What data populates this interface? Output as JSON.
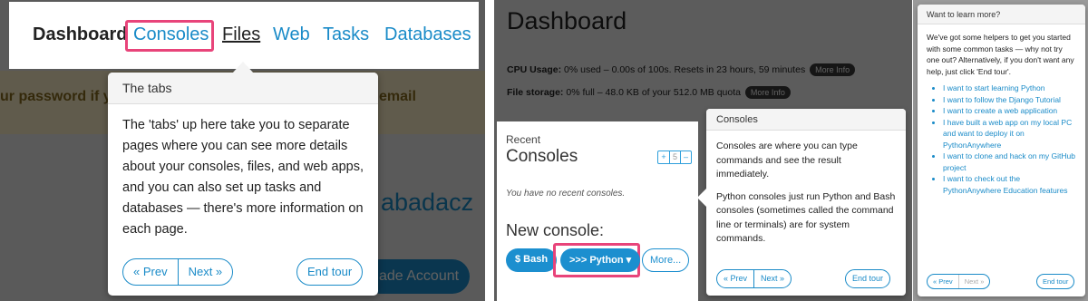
{
  "colors": {
    "accent": "#1a8bc8",
    "highlight": "#e8447a",
    "warning_bg": "#fbf0c9"
  },
  "panel1": {
    "nav": {
      "dashboard": "Dashboard",
      "consoles": "Consoles",
      "files": "Files",
      "web": "Web",
      "tasks": "Tasks",
      "databases": "Databases"
    },
    "background": {
      "warning_left": "ur password if you",
      "warning_right": "email",
      "user_link": "abadacz",
      "upgrade_button": "ade Account"
    },
    "tooltip": {
      "title": "The tabs",
      "body": "The 'tabs' up here take you to separate pages where you can see more details about your consoles, files, and web apps, and you can also set up tasks and databases — there's more information on each page.",
      "prev": "« Prev",
      "next": "Next »",
      "end": "End tour"
    }
  },
  "panel2": {
    "title": "Dashboard",
    "cpu": {
      "label": "CPU Usage:",
      "text": "0% used – 0.00s of 100s. Resets in 23 hours, 59 minutes",
      "more": "More Info"
    },
    "storage": {
      "label": "File storage:",
      "text": "0% full – 48.0 KB of your 512.0 MB quota",
      "more": "More Info"
    },
    "recent_label": "Recent",
    "consoles_heading": "Consoles",
    "stepper": {
      "plus": "+",
      "value": "5",
      "minus": "–"
    },
    "no_consoles": "You have no recent consoles.",
    "new_console": "New console:",
    "bash_button": "$ Bash",
    "python_button": ">>> Python ▾",
    "more_button": "More...",
    "tooltip": {
      "title": "Consoles",
      "p1": "Consoles are where you can type commands and see the result immediately.",
      "p2": "Python consoles just run Python and Bash consoles (sometimes called the command line or terminals) are for system commands.",
      "prev": "« Prev",
      "next": "Next »",
      "end": "End tour"
    }
  },
  "panel3": {
    "tooltip": {
      "title": "Want to learn more?",
      "body": "We've got some helpers to get you started with some common tasks — why not try one out? Alternatively, if you don't want any help, just click 'End tour'.",
      "links": [
        "I want to start learning Python",
        "I want to follow the Django Tutorial",
        "I want to create a web application",
        "I have built a web app on my local PC and want to deploy it on PythonAnywhere",
        "I want to clone and hack on my GitHub project",
        "I want to check out the PythonAnywhere Education features"
      ],
      "prev": "« Prev",
      "next": "Next »",
      "end": "End tour"
    }
  }
}
